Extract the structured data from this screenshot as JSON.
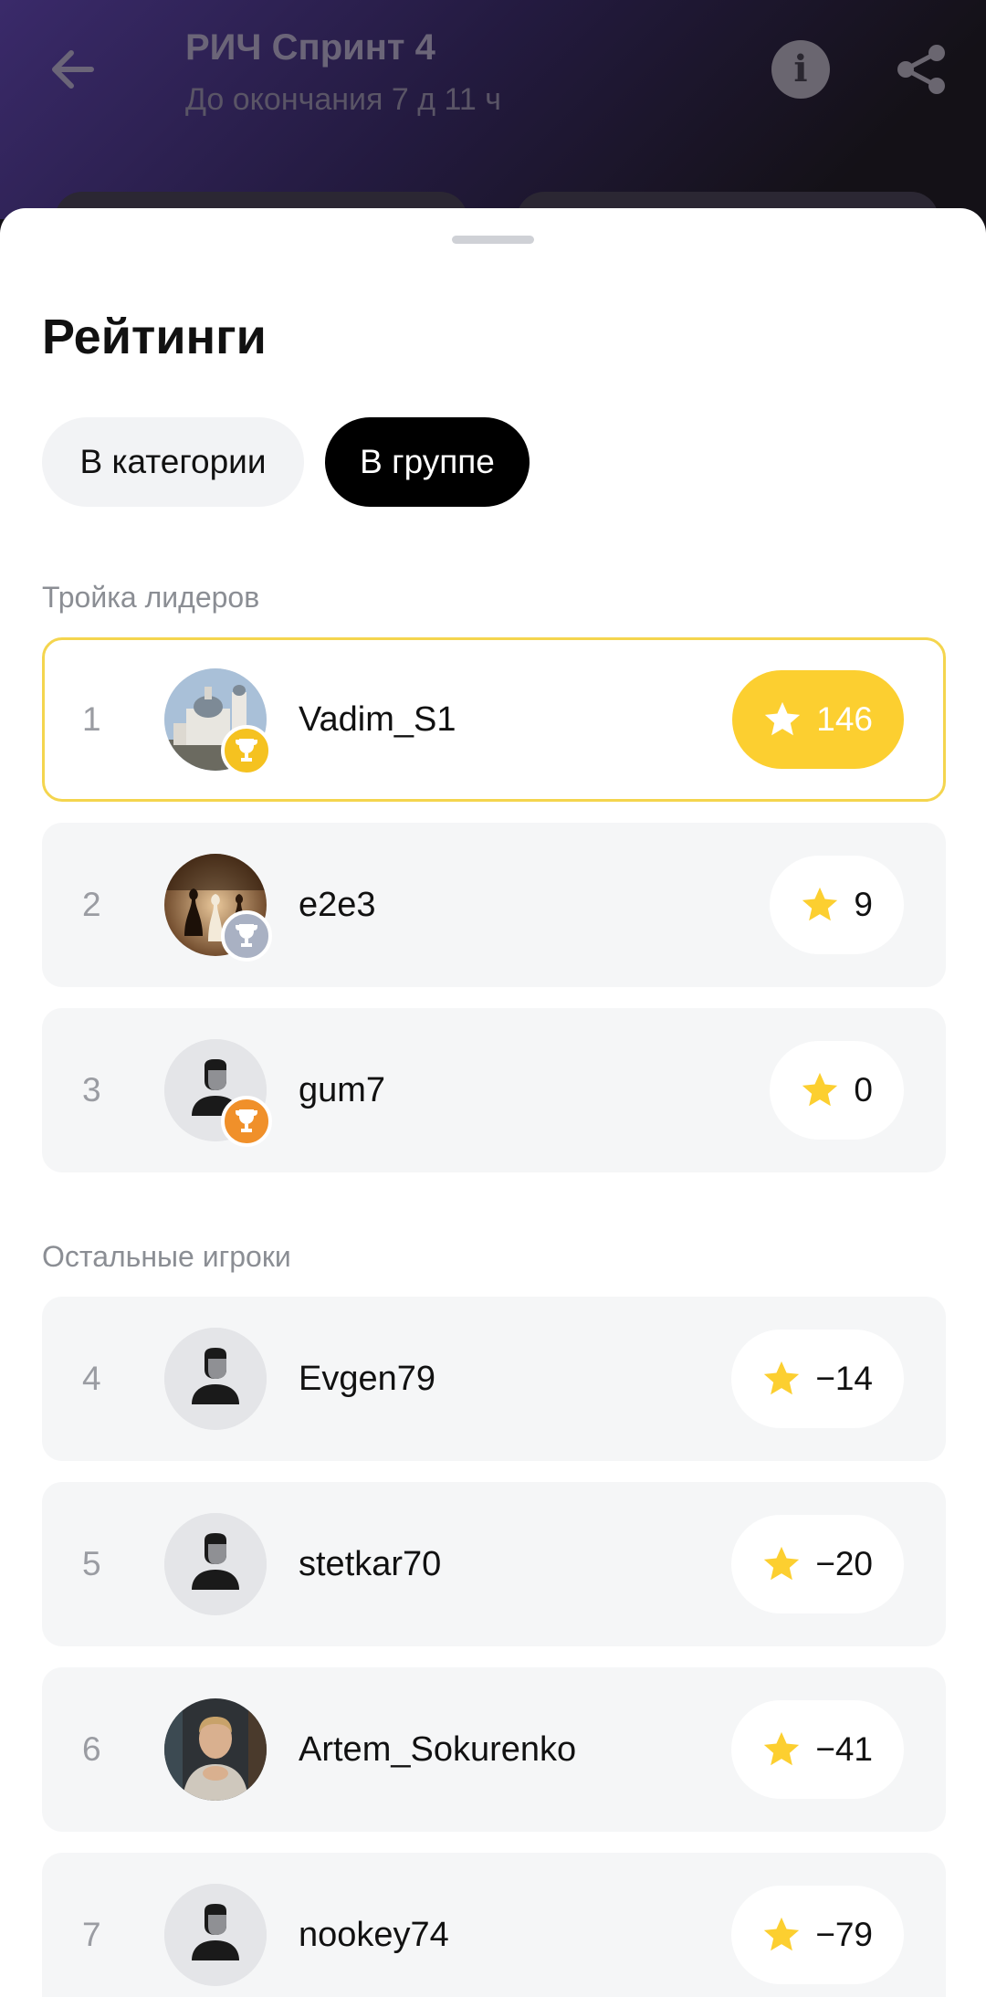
{
  "header": {
    "title": "РИЧ Спринт 4",
    "subtitle": "До окончания 7 д 11 ч",
    "back_icon": "arrow-left-icon",
    "info_icon": "info-icon",
    "share_icon": "share-icon"
  },
  "sheet": {
    "title": "Рейтинги",
    "tabs": [
      {
        "label": "В категории",
        "active": false
      },
      {
        "label": "В группе",
        "active": true
      }
    ],
    "leaders_label": "Тройка лидеров",
    "others_label": "Остальные игроки",
    "leaders": [
      {
        "rank": "1",
        "name": "Vadim_S1",
        "score": "146",
        "trophy": "gold",
        "avatar": "church-photo"
      },
      {
        "rank": "2",
        "name": "e2e3",
        "score": "9",
        "trophy": "silver",
        "avatar": "chess-photo"
      },
      {
        "rank": "3",
        "name": "gum7",
        "score": "0",
        "trophy": "bronze",
        "avatar": "default-person"
      }
    ],
    "others": [
      {
        "rank": "4",
        "name": "Evgen79",
        "score": "−14",
        "avatar": "default-person"
      },
      {
        "rank": "5",
        "name": "stetkar70",
        "score": "−20",
        "avatar": "default-person"
      },
      {
        "rank": "6",
        "name": "Artem_Sokurenko",
        "score": "−41",
        "avatar": "portrait-photo"
      },
      {
        "rank": "7",
        "name": "nookey74",
        "score": "−79",
        "avatar": "default-person"
      }
    ]
  },
  "colors": {
    "accent_yellow": "#fccf30",
    "gold": "#f5c220",
    "silver": "#a9b1c3",
    "bronze": "#f0902a",
    "active_tab": "#000000"
  }
}
